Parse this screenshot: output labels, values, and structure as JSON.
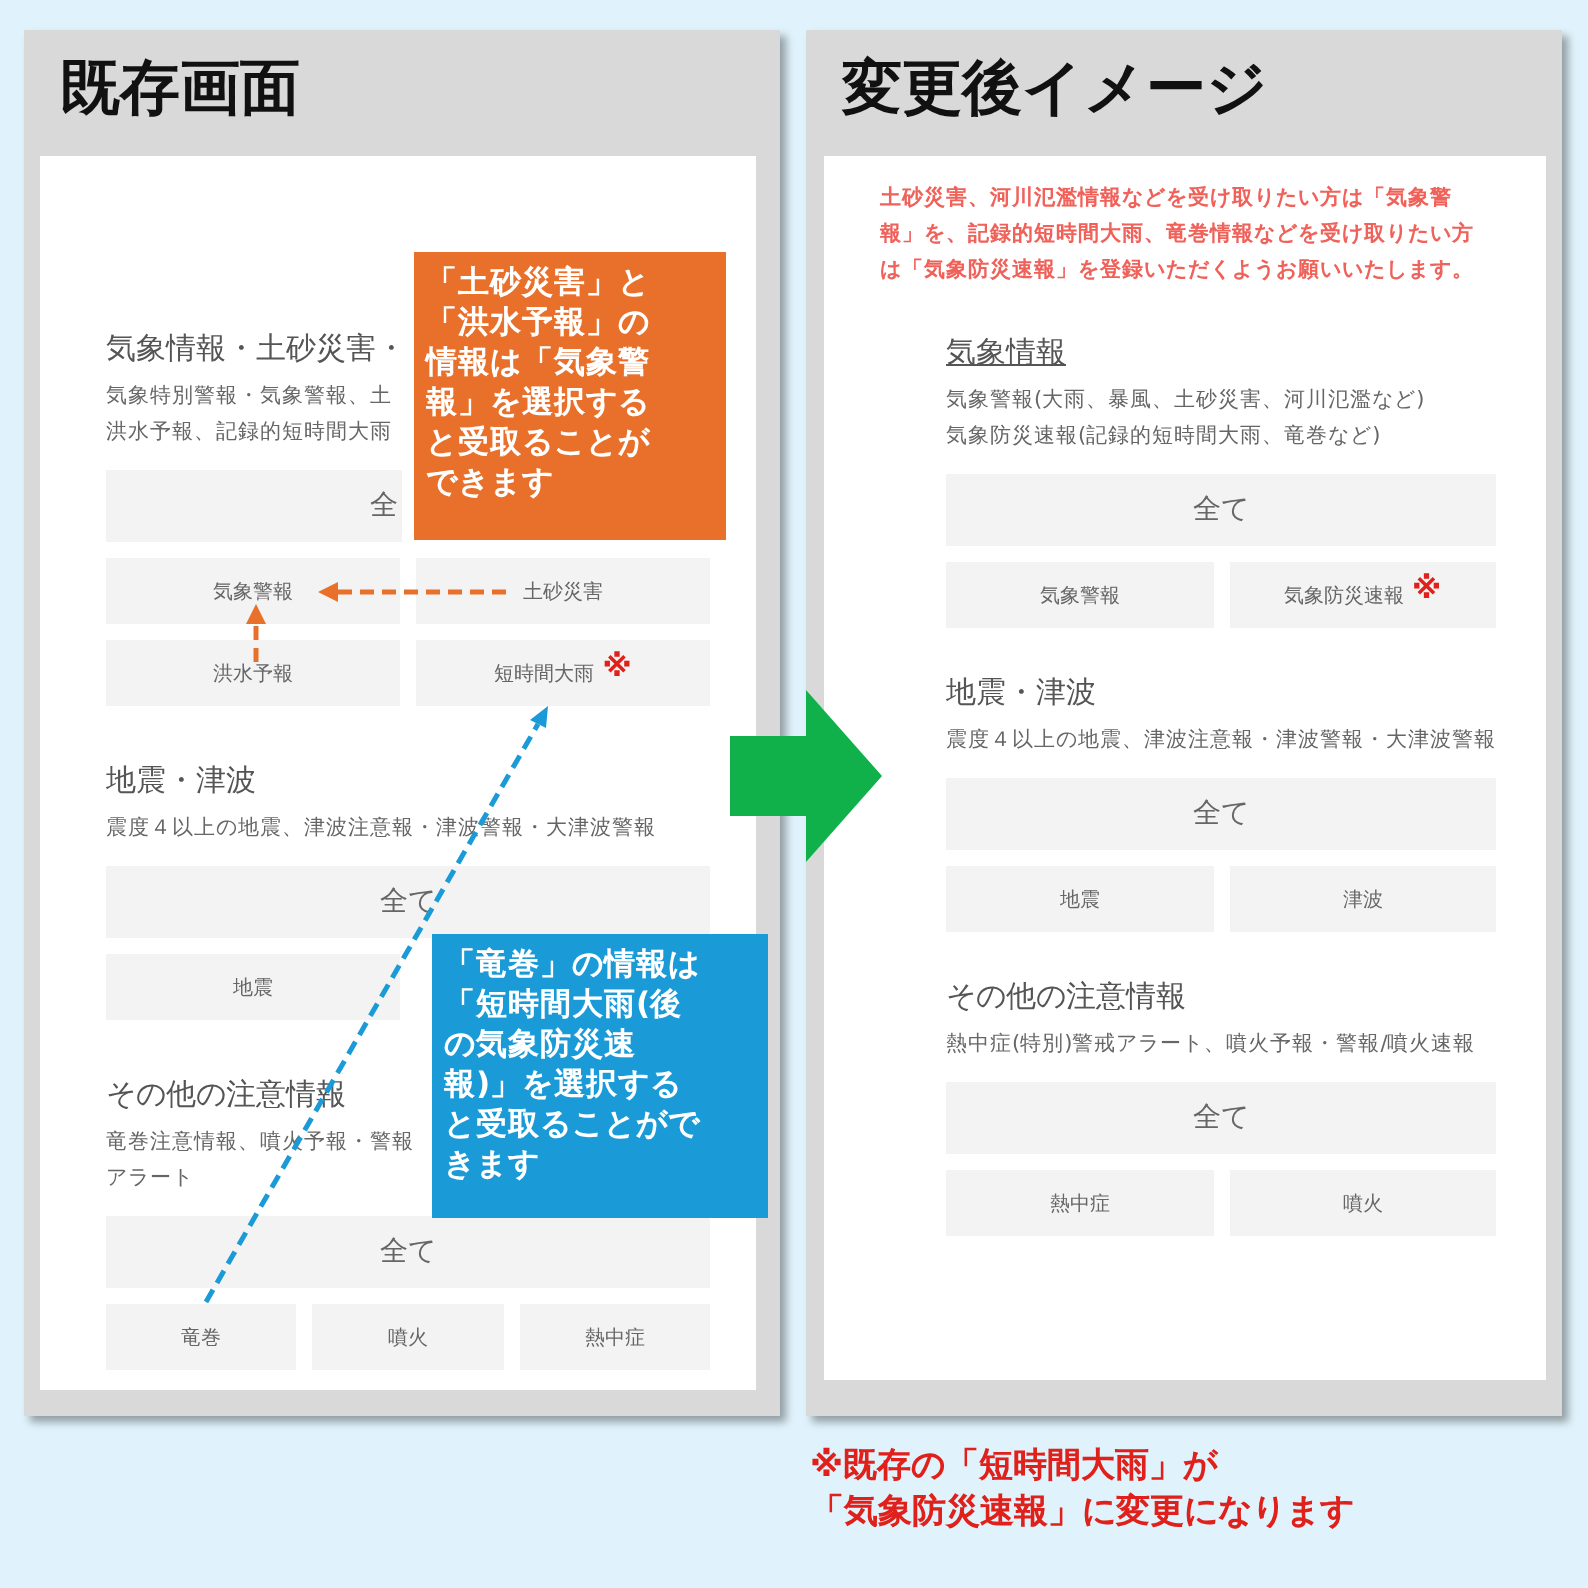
{
  "before": {
    "title": "既存画面",
    "sections": [
      {
        "title": "気象情報・土砂災害・",
        "underlined": false,
        "description": [
          "気象特別警報・気象警報、土",
          "洪水予報、記録的短時間大雨"
        ],
        "all_button": {
          "kind": "partial",
          "label": "全"
        },
        "option_rows": [
          [
            {
              "kind": "option",
              "label": "気象警報"
            },
            {
              "kind": "option",
              "label": "土砂災害"
            }
          ],
          [
            {
              "kind": "option",
              "label": "洪水予報"
            },
            {
              "kind": "option",
              "label": "短時間大雨",
              "mark": "※"
            }
          ]
        ]
      },
      {
        "title": "地震・津波",
        "underlined": false,
        "description": [
          "震度４以上の地震、津波注意報・津波警報・大津波警報"
        ],
        "all_button": {
          "kind": "all",
          "label": "全て"
        },
        "option_rows": [
          [
            {
              "kind": "option",
              "label": "地震"
            },
            {
              "kind": "blank"
            }
          ]
        ]
      },
      {
        "title": "その他の注意情報",
        "underlined": false,
        "description": [
          "竜巻注意情報、噴火予報・警報",
          "アラート"
        ],
        "all_button": {
          "kind": "all",
          "label": "全て"
        },
        "option_rows": [
          [
            {
              "kind": "option",
              "label": "竜巻"
            },
            {
              "kind": "option",
              "label": "噴火"
            },
            {
              "kind": "option",
              "label": "熱中症"
            }
          ]
        ]
      }
    ],
    "callouts": [
      {
        "color": "#e8702a",
        "lines": [
          "「土砂災害」と",
          "「洪水予報」の",
          "情報は「気象警",
          "報」を選択する",
          "と受取ることが",
          "できます"
        ]
      },
      {
        "color": "#1a9ad6",
        "lines": [
          "「竜巻」の情報は",
          "「短時間大雨(後",
          "の気象防災速",
          "報)」を選択する",
          "と受取ることがで",
          "きます"
        ]
      }
    ]
  },
  "after": {
    "title": "変更後イメージ",
    "notice": "土砂災害、河川氾濫情報などを受け取りたい方は「気象警報」を、記録的短時間大雨、竜巻情報などを受け取りたい方は「気象防災速報」を登録いただくようお願いいたします。",
    "sections": [
      {
        "title": "気象情報",
        "underlined": true,
        "description": [
          "気象警報(大雨、暴風、土砂災害、河川氾濫など)",
          "気象防災速報(記録的短時間大雨、竜巻など)"
        ],
        "all_button": {
          "kind": "all",
          "label": "全て"
        },
        "option_rows": [
          [
            {
              "kind": "option",
              "label": "気象警報"
            },
            {
              "kind": "option",
              "label": "気象防災速報",
              "mark": "※"
            }
          ]
        ]
      },
      {
        "title": "地震・津波",
        "underlined": false,
        "description": [
          "震度４以上の地震、津波注意報・津波警報・大津波警報"
        ],
        "all_button": {
          "kind": "all",
          "label": "全て"
        },
        "option_rows": [
          [
            {
              "kind": "option",
              "label": "地震"
            },
            {
              "kind": "option",
              "label": "津波"
            }
          ]
        ]
      },
      {
        "title": "その他の注意情報",
        "underlined": false,
        "description": [
          "熱中症(特別)警戒アラート、噴火予報・警報/噴火速報"
        ],
        "all_button": {
          "kind": "all",
          "label": "全て"
        },
        "option_rows": [
          [
            {
              "kind": "option",
              "label": "熱中症"
            },
            {
              "kind": "option",
              "label": "噴火"
            }
          ]
        ]
      }
    ]
  },
  "footnote": [
    "※既存の「短時間大雨」が",
    "「気象防災速報」に変更になります"
  ]
}
